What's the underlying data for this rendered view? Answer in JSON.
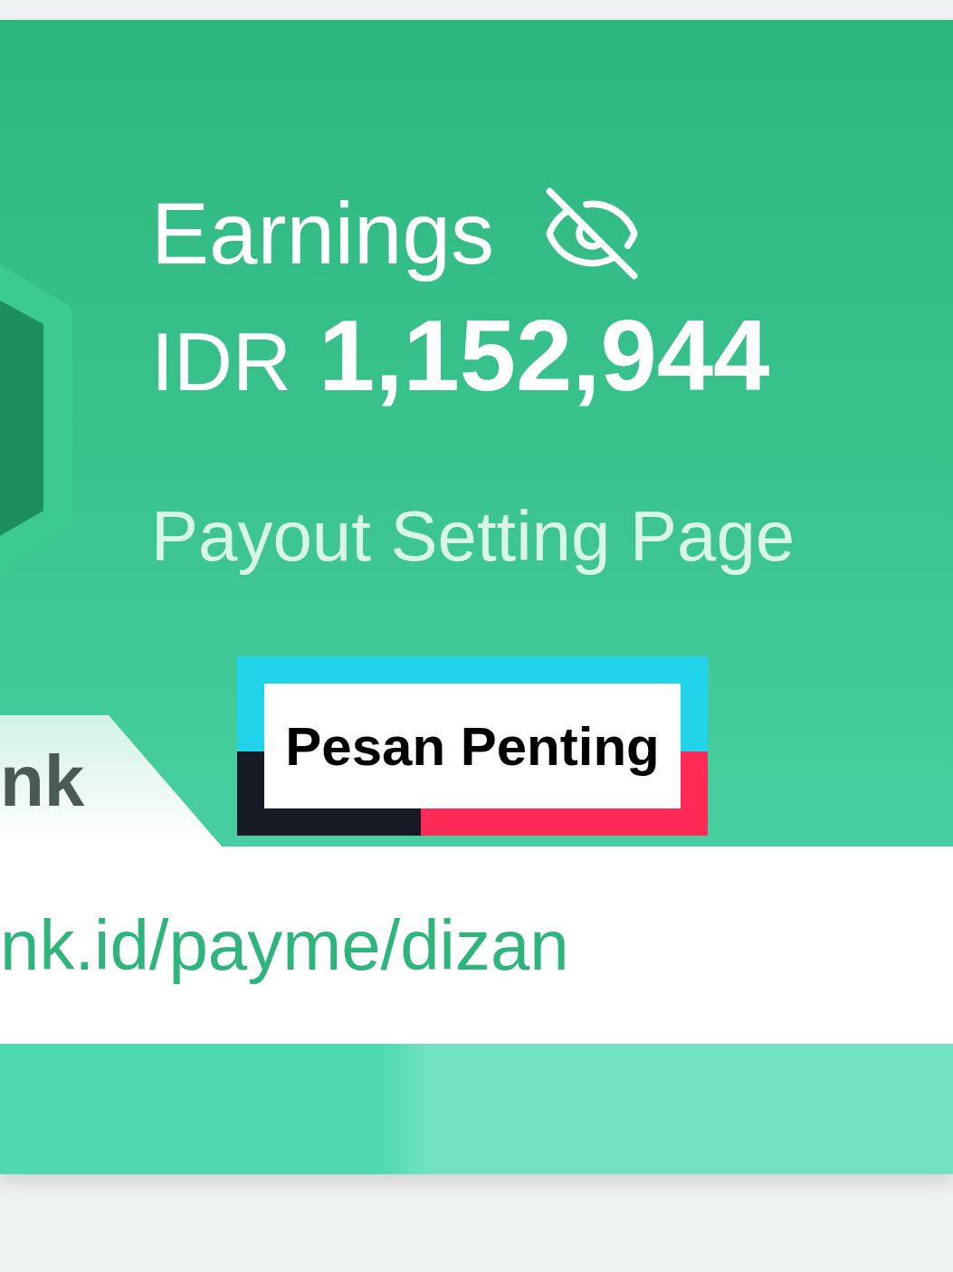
{
  "earnings": {
    "title": "Earnings",
    "currency": "IDR",
    "amount": "1,152,944",
    "link": "Payout Setting Page"
  },
  "link_tab": {
    "label": "nk"
  },
  "link_field": {
    "value": "nk.id/payme/dizan"
  },
  "sticker": {
    "text": "Pesan Penting"
  }
}
